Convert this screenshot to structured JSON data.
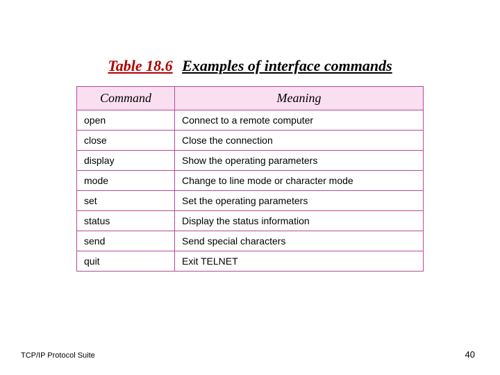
{
  "title": {
    "label": "Table 18.6",
    "text": "Examples of interface commands"
  },
  "table": {
    "headers": {
      "command": "Command",
      "meaning": "Meaning"
    },
    "rows": [
      {
        "command": "open",
        "meaning": "Connect to a remote computer"
      },
      {
        "command": "close",
        "meaning": "Close the connection"
      },
      {
        "command": "display",
        "meaning": "Show the operating parameters"
      },
      {
        "command": "mode",
        "meaning": "Change to line mode or character mode"
      },
      {
        "command": "set",
        "meaning": "Set the operating parameters"
      },
      {
        "command": "status",
        "meaning": "Display the status information"
      },
      {
        "command": "send",
        "meaning": "Send special characters"
      },
      {
        "command": "quit",
        "meaning": "Exit TELNET"
      }
    ]
  },
  "footer": {
    "source": "TCP/IP Protocol Suite",
    "page": "40"
  }
}
